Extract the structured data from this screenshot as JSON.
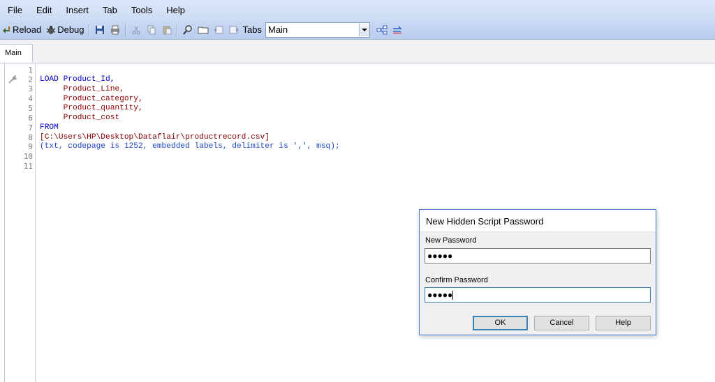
{
  "menu": [
    "File",
    "Edit",
    "Insert",
    "Tab",
    "Tools",
    "Help"
  ],
  "toolbar": {
    "reload_label": "Reload",
    "debug_label": "Debug",
    "tabs_label": "Tabs",
    "tab_select_value": "Main"
  },
  "tabs": [
    {
      "label": "Main"
    }
  ],
  "editor": {
    "line_numbers": [
      "1",
      "2",
      "3",
      "4",
      "5",
      "6",
      "7",
      "8",
      "9",
      "10",
      "11"
    ],
    "lines": [
      "",
      "LOAD Product_Id,",
      "     Product_Line,",
      "     Product_category,",
      "     Product_quantity,",
      "     Product_cost",
      "FROM",
      "[C:\\Users\\HP\\Desktop\\Dataflair\\productrecord.csv]",
      "(txt, codepage is 1252, embedded labels, delimiter is ',', msq);",
      "",
      ""
    ]
  },
  "dialog": {
    "title": "New Hidden Script Password",
    "new_password_label": "New Password",
    "new_password_value": "●●●●●",
    "confirm_password_label": "Confirm Password",
    "confirm_password_value": "●●●●●",
    "ok_label": "OK",
    "cancel_label": "Cancel",
    "help_label": "Help"
  }
}
